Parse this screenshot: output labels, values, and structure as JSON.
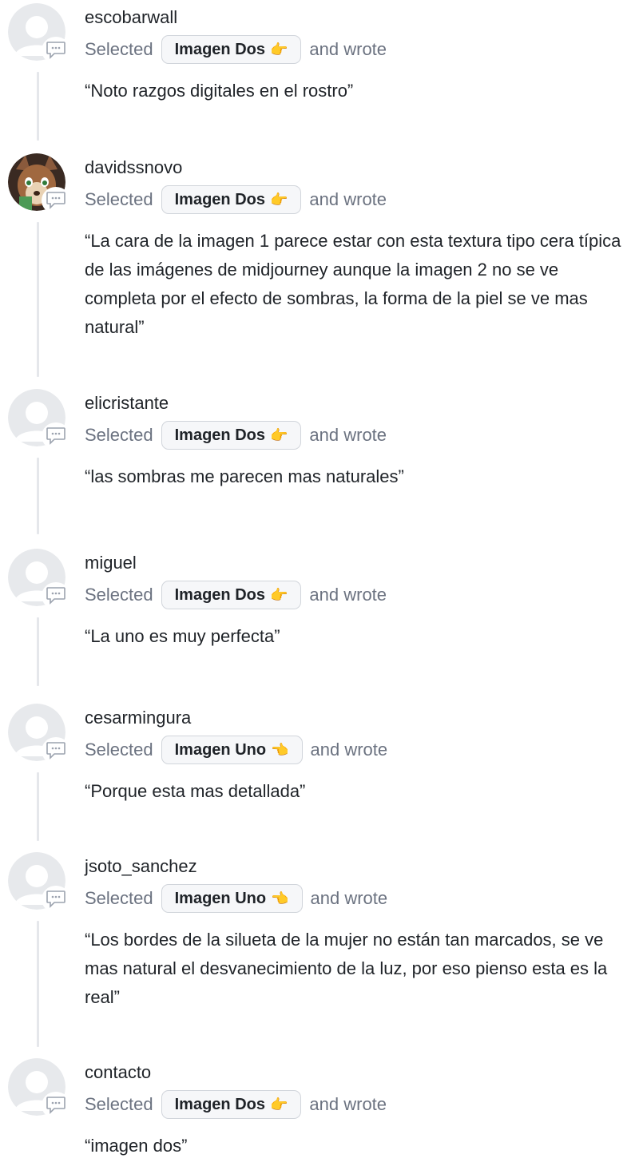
{
  "labels": {
    "selected": "Selected",
    "wrote": "and wrote"
  },
  "colors": {
    "thread_line": "#e5e7eb",
    "chip_bg": "#f6f7f9",
    "muted_text": "#6b7280"
  },
  "entries": [
    {
      "username": "escobarwall",
      "avatar": "default-avatar",
      "choice": "Imagen Dos",
      "hand_icon": "hand-pointing-left-icon",
      "hand": "👉",
      "quote": "“Noto razgos digitales en el rostro”"
    },
    {
      "username": "davidssnovo",
      "avatar": "custom-avatar",
      "choice": "Imagen Dos",
      "hand_icon": "hand-pointing-left-icon",
      "hand": "👉",
      "quote": "“La cara de la imagen 1 parece estar con esta textura tipo cera típica de las imágenes de midjourney aunque la imagen 2 no se ve completa por el efecto de sombras, la forma de la piel se ve mas natural”"
    },
    {
      "username": "elicristante",
      "avatar": "default-avatar",
      "choice": "Imagen Dos",
      "hand_icon": "hand-pointing-left-icon",
      "hand": "👉",
      "quote": "“las sombras me parecen mas naturales”"
    },
    {
      "username": "miguel",
      "avatar": "default-avatar",
      "choice": "Imagen Dos",
      "hand_icon": "hand-pointing-left-icon",
      "hand": "👉",
      "quote": "“La uno es muy perfecta”"
    },
    {
      "username": "cesarmingura",
      "avatar": "default-avatar",
      "choice": "Imagen Uno",
      "hand_icon": "hand-pointing-right-icon",
      "hand": "👈",
      "quote": "“Porque esta mas detallada”"
    },
    {
      "username": "jsoto_sanchez",
      "avatar": "default-avatar",
      "choice": "Imagen Uno",
      "hand_icon": "hand-pointing-right-icon",
      "hand": "👈",
      "quote": "“Los bordes de la silueta de la mujer no están tan marcados, se ve mas natural el desvanecimiento de la luz, por eso pienso esta es la real”"
    },
    {
      "username": "contacto",
      "avatar": "default-avatar",
      "choice": "Imagen Dos",
      "hand_icon": "hand-pointing-left-icon",
      "hand": "👉",
      "quote": "“imagen dos”"
    }
  ]
}
